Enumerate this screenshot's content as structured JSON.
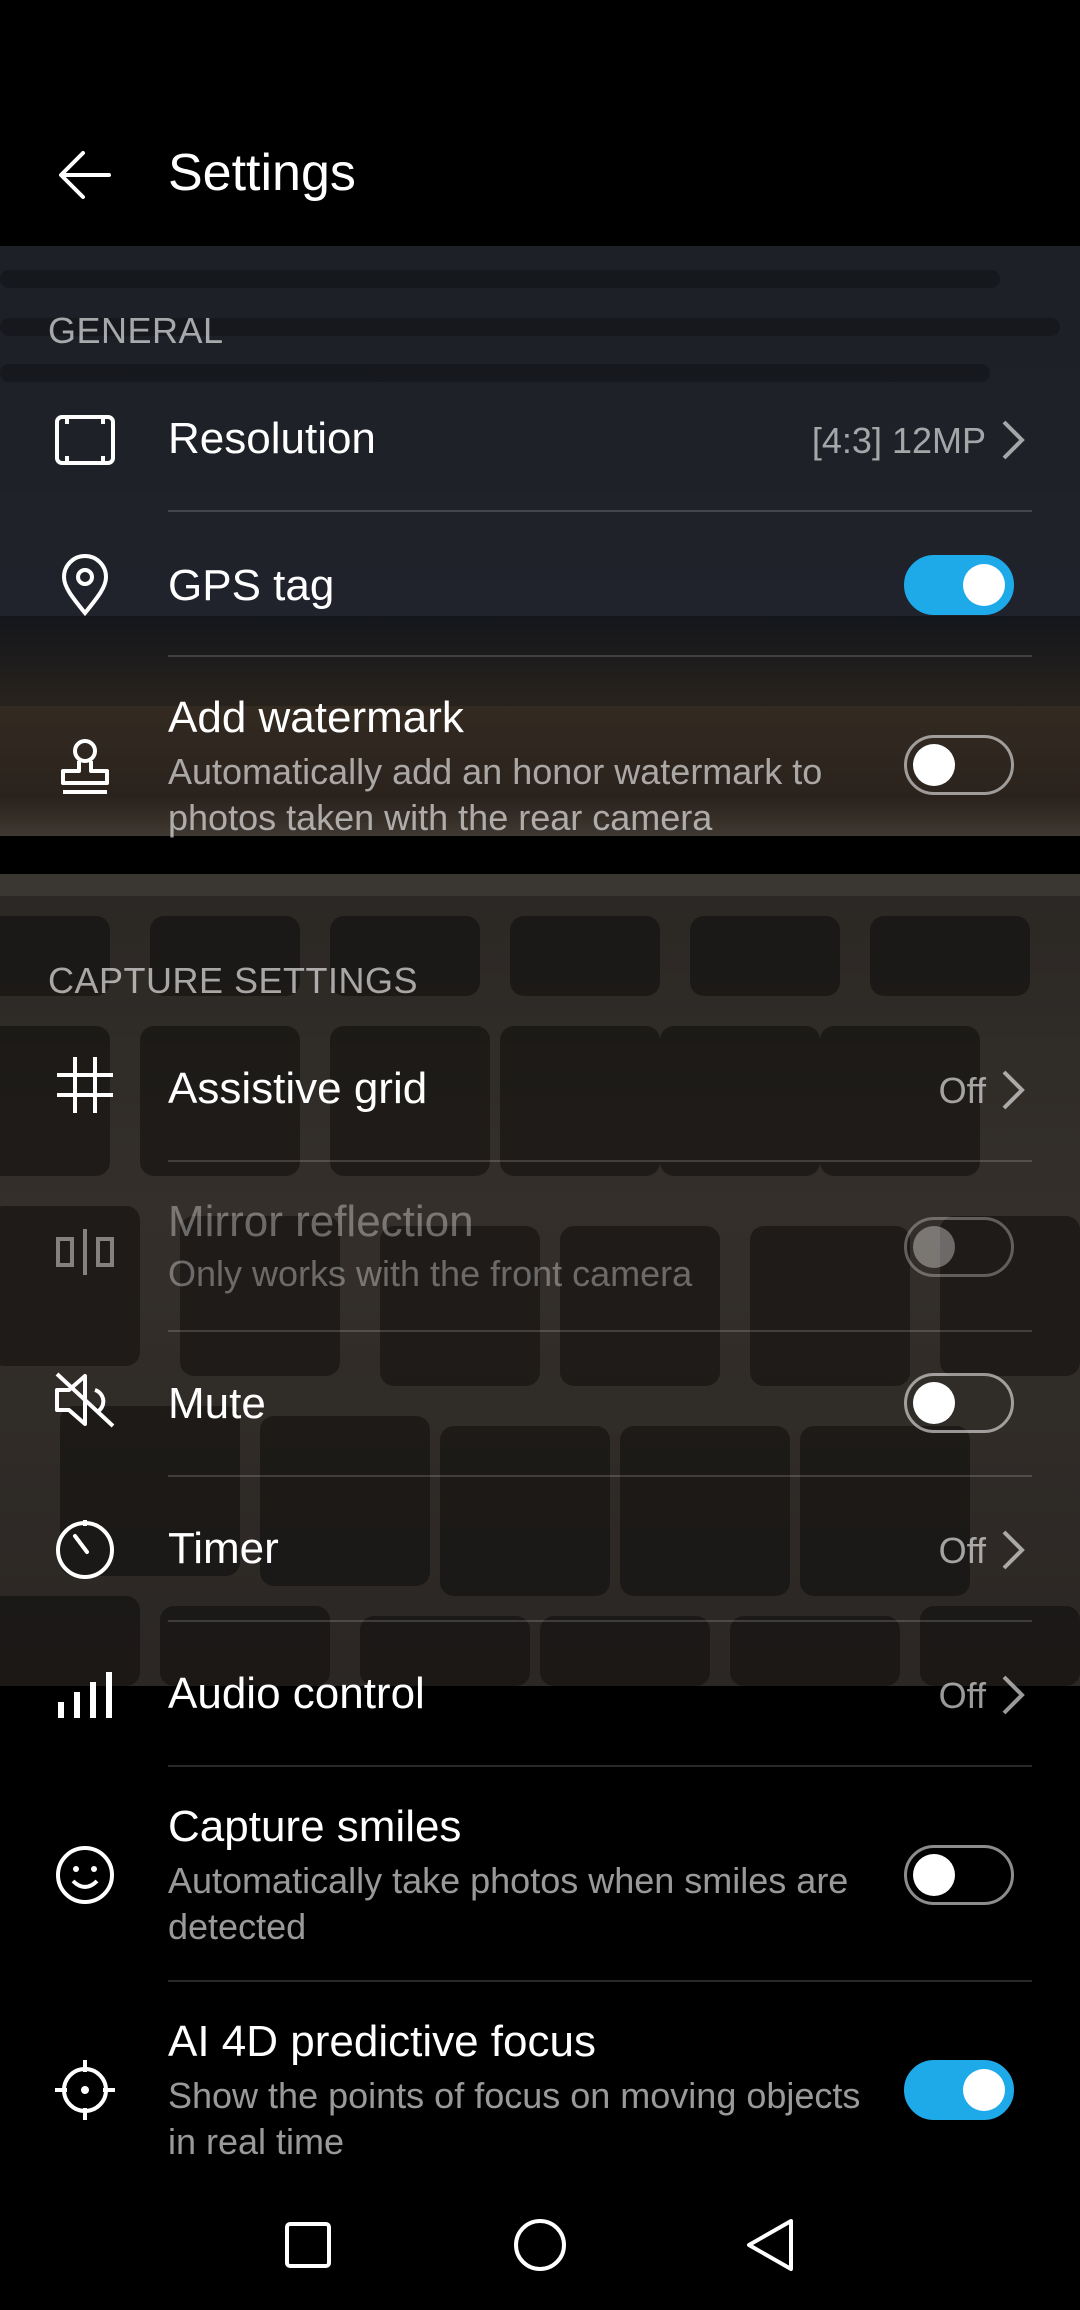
{
  "app": {
    "title": "Settings"
  },
  "sections": {
    "general": "GENERAL",
    "capture": "CAPTURE SETTINGS"
  },
  "rows": {
    "resolution": {
      "label": "Resolution",
      "value": "[4:3] 12MP",
      "icon": "aspect-frame-icon"
    },
    "gps": {
      "label": "GPS tag",
      "state": true,
      "icon": "location-pin-icon"
    },
    "watermark": {
      "label": "Add watermark",
      "sub": "Automatically add an honor watermark to photos taken with the rear camera",
      "state": false,
      "icon": "stamp-icon"
    },
    "grid": {
      "label": "Assistive grid",
      "value": "Off",
      "icon": "grid-icon"
    },
    "mirror": {
      "label": "Mirror reflection",
      "sub": "Only works with the front camera",
      "state": false,
      "enabled": false,
      "icon": "mirror-icon"
    },
    "mute": {
      "label": "Mute",
      "state": false,
      "icon": "speaker-muted-icon"
    },
    "timer": {
      "label": "Timer",
      "value": "Off",
      "icon": "timer-icon"
    },
    "audio": {
      "label": "Audio control",
      "value": "Off",
      "icon": "audio-bars-icon"
    },
    "smiles": {
      "label": "Capture smiles",
      "sub": "Automatically take photos when smiles are detected",
      "state": false,
      "icon": "smile-icon"
    },
    "focus": {
      "label": "AI 4D predictive focus",
      "sub": "Show the points of focus on moving objects in real time",
      "state": true,
      "icon": "focus-target-icon"
    }
  },
  "colors": {
    "accent": "#1eaae8",
    "background": "#000000"
  }
}
